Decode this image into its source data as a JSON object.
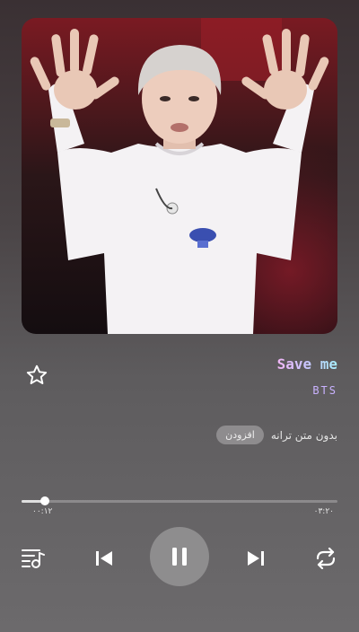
{
  "track": {
    "title": "Save me",
    "artist": "BTS",
    "favorite": false
  },
  "lyrics": {
    "status_text": "بدون متن ترانه",
    "add_label": "افزودن"
  },
  "progress": {
    "elapsed": "۰۰:۱۲",
    "total": "۰۳:۲۰",
    "fraction": 0.074
  },
  "controls": {
    "queue_icon": "queue-music-icon",
    "prev_icon": "skip-previous-icon",
    "play_pause_icon": "pause-icon",
    "next_icon": "skip-next-icon",
    "repeat_icon": "repeat-icon"
  },
  "colors": {
    "title_gradient": [
      "#f2b6f7",
      "#a8f0ff"
    ],
    "artist": "#c9b2ff",
    "play_button": "#8e8d8e"
  }
}
